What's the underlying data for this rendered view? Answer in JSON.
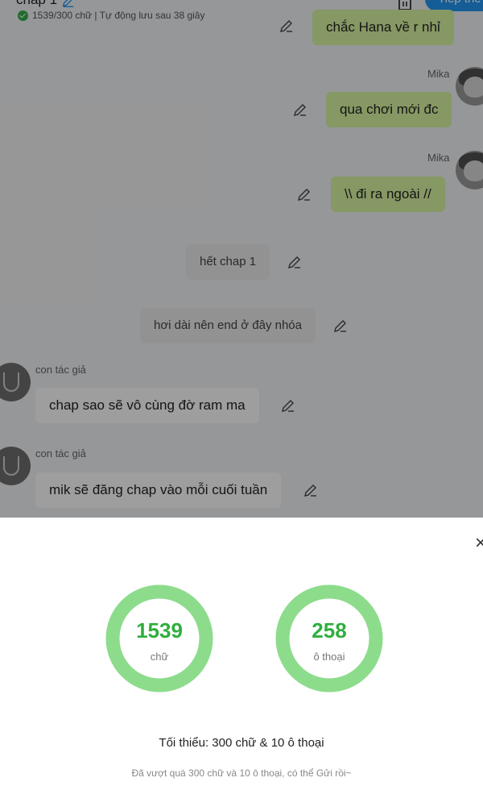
{
  "header": {
    "title": "chap 1",
    "word_status": "1539/300 chữ | Tự động lưu sau 38 giây",
    "continue_label": "Tiếp the"
  },
  "messages": [
    {
      "kind": "right",
      "text": "chắc Hana về r nhỉ"
    },
    {
      "kind": "right",
      "name": "Mika",
      "text": "qua chơi mới đc"
    },
    {
      "kind": "right",
      "name": "Mika",
      "text": "\\\\ đi ra ngoài //"
    },
    {
      "kind": "narration",
      "text": "hết chap 1"
    },
    {
      "kind": "narration",
      "text": "hơi dài nên end ở đây nhóa"
    },
    {
      "kind": "left",
      "name": "con tác giả",
      "text": "chap sao sẽ vô cùng đờ ram ma"
    },
    {
      "kind": "left",
      "name": "con tác giả",
      "text": "mik sẽ đăng chap vào mỗi cuối tuần"
    }
  ],
  "stats": {
    "words": {
      "value": "1539",
      "label": "chữ",
      "progress": 1.0
    },
    "dialogues": {
      "value": "258",
      "label": "ô thoại",
      "progress": 1.0
    },
    "ring_color": "#8cdc8c",
    "accent_color": "#2fae3e",
    "min_requirement": "Tối thiểu: 300 chữ & 10 ô thoại",
    "note": "Đã vượt quá 300 chữ và 10 ô thoại, có thể Gửi rồi~"
  },
  "close_label": "×"
}
